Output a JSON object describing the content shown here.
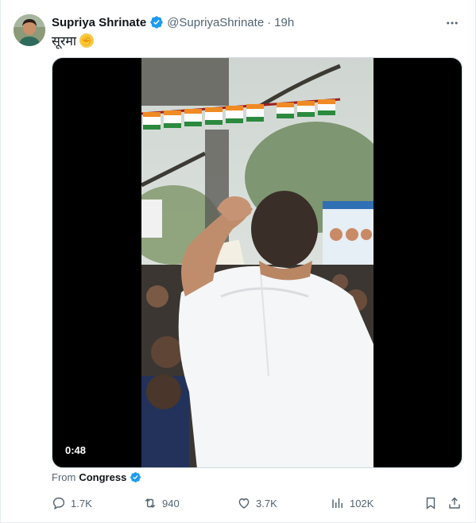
{
  "tweet": {
    "author_name": "Supriya Shrinate",
    "author_handle": "@SupriyaShrinate",
    "separator": "·",
    "time": "19h",
    "text": "सूरमा",
    "emoji_icon": "raised-fist-icon"
  },
  "video": {
    "duration": "0:48"
  },
  "source": {
    "prefix": "From",
    "name": "Congress"
  },
  "actions": {
    "replies": "1.7K",
    "reposts": "940",
    "likes": "3.7K",
    "views": "102K"
  },
  "colors": {
    "verified": "#1d9bf0",
    "muted": "#536471",
    "text": "#0f1419"
  }
}
